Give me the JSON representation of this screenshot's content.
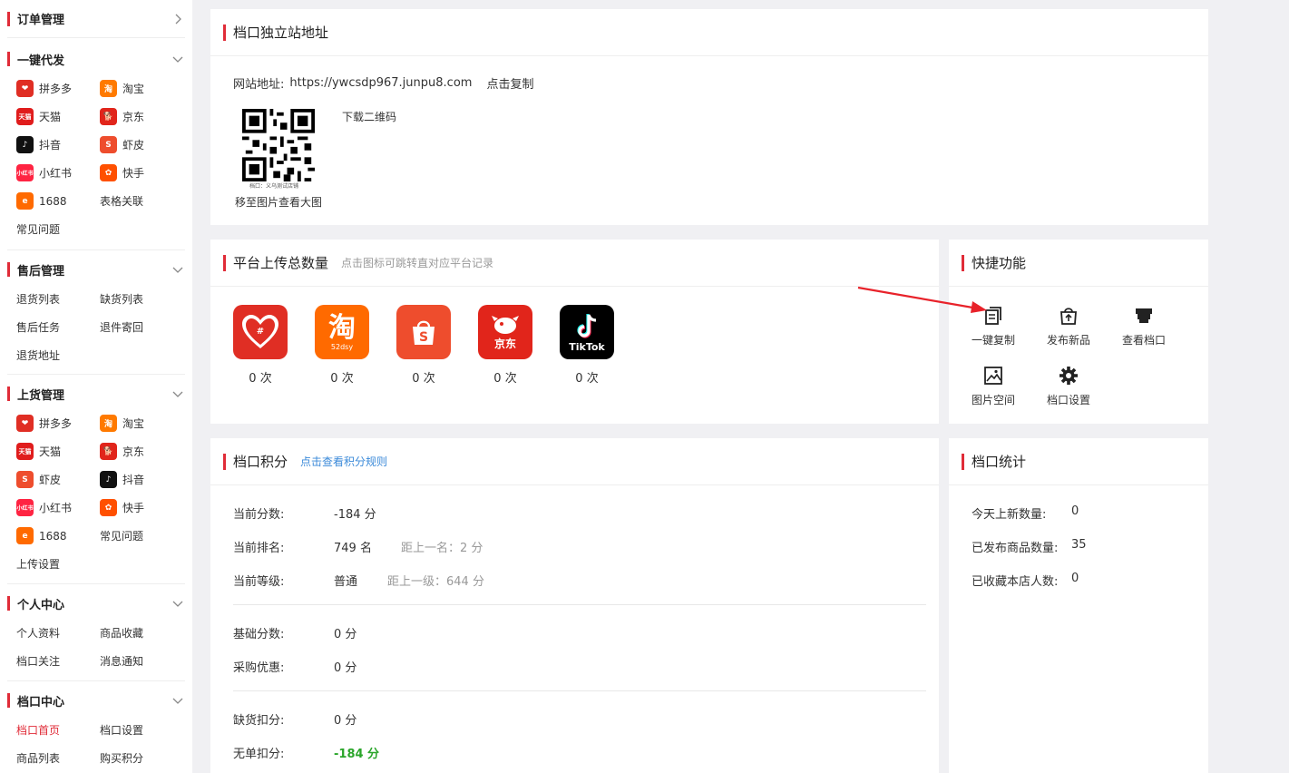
{
  "sidebar": {
    "order": {
      "title": "订单管理"
    },
    "dropship": {
      "title": "一键代发",
      "items": [
        "拼多多",
        "淘宝",
        "天猫",
        "京东",
        "抖音",
        "虾皮",
        "小红书",
        "快手",
        "1688",
        "表格关联",
        "常见问题"
      ]
    },
    "aftersale": {
      "title": "售后管理",
      "items": [
        "退货列表",
        "缺货列表",
        "售后任务",
        "退件寄回",
        "退货地址"
      ]
    },
    "upload": {
      "title": "上货管理",
      "items": [
        "拼多多",
        "淘宝",
        "天猫",
        "京东",
        "虾皮",
        "抖音",
        "小红书",
        "快手",
        "1688",
        "常见问题",
        "上传设置"
      ]
    },
    "personal": {
      "title": "个人中心",
      "items": [
        "个人资料",
        "商品收藏",
        "档口关注",
        "消息通知"
      ]
    },
    "stall": {
      "title": "档口中心",
      "items": [
        "档口首页",
        "档口设置",
        "商品列表",
        "购买积分"
      ]
    }
  },
  "site": {
    "title": "档口独立站地址",
    "address_label": "网站地址:",
    "address": "https://ywcsdp967.junpu8.com",
    "copy": "点击复制",
    "download_qr": "下载二维码",
    "qr_caption": "档口：义乌测试店铺",
    "hover_tip": "移至图片查看大图"
  },
  "platforms": {
    "title": "平台上传总数量",
    "hint": "点击图标可跳转直对应平台记录",
    "list": [
      {
        "name": "拼多多",
        "logo_text": "",
        "count": "0 次",
        "color": "#e02e24"
      },
      {
        "name": "淘宝",
        "logo_text": "淘",
        "sub": "52dsy",
        "count": "0 次",
        "color": "#ff6a00"
      },
      {
        "name": "虾皮",
        "logo_text": "S",
        "count": "0 次",
        "color": "#ee4d2d"
      },
      {
        "name": "京东",
        "logo_text": "京东",
        "count": "0 次",
        "color": "#e1251b"
      },
      {
        "name": "TikTok",
        "logo_text": "TikTok",
        "count": "0 次",
        "color": "#000000"
      }
    ]
  },
  "quick": {
    "title": "快捷功能",
    "items": [
      "一键复制",
      "发布新品",
      "查看档口",
      "图片空间",
      "档口设置"
    ]
  },
  "points": {
    "title": "档口积分",
    "rule_link": "点击查看积分规则",
    "current_score_label": "当前分数:",
    "current_score": "-184 分",
    "rank_label": "当前排名:",
    "rank": "749 名",
    "rank_gap": "距上一名：2 分",
    "level_label": "当前等级:",
    "level": "普通",
    "level_gap": "距上一级：644 分",
    "base_label": "基础分数:",
    "base": "0 分",
    "purchase_label": "采购优惠:",
    "purchase": "0 分",
    "stockout_label": "缺货扣分:",
    "stockout": "0 分",
    "noorder_label": "无单扣分:",
    "noorder": "-184 分"
  },
  "stats": {
    "title": "档口统计",
    "today_label": "今天上新数量:",
    "today": "0",
    "published_label": "已发布商品数量:",
    "published": "35",
    "fav_label": "已收藏本店人数:",
    "fav": "0"
  },
  "colors": {
    "accent": "#e02c38",
    "link": "#3b8ad9",
    "green": "#2aa52a"
  }
}
